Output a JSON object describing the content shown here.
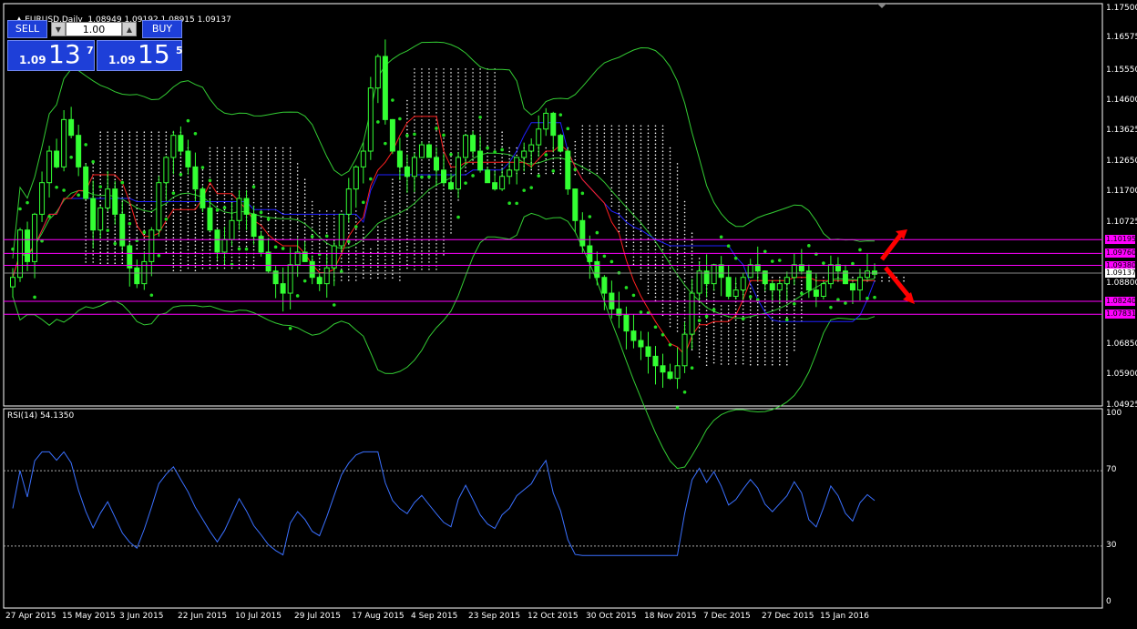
{
  "header": {
    "symbol": "EURUSD",
    "timeframe": ",Daily",
    "ohlc": "1.08949 1.09192 1.08915 1.09137"
  },
  "trade_panel": {
    "sell_label": "SELL",
    "buy_label": "BUY",
    "lot": "1.00",
    "sell_small": "1.09",
    "sell_big": "13",
    "sell_sup": "7",
    "buy_small": "1.09",
    "buy_big": "15",
    "buy_sup": "5",
    "spin_down": "▼",
    "spin_up": "▲"
  },
  "price_axis": {
    "labels": [
      "1.17500",
      "1.16575",
      "1.15550",
      "1.14600",
      "1.13625",
      "1.12650",
      "1.11700",
      "1.10725",
      "1.08800",
      "1.06850",
      "1.05900",
      "1.04925"
    ],
    "current_price": "1.09137",
    "level_tags": [
      "1.10195",
      "1.09760",
      "1.09380",
      "1.08240",
      "1.07831"
    ]
  },
  "rsi": {
    "title": "RSI(14) 54.1350",
    "axis_labels": [
      "100",
      "70",
      "30",
      "0"
    ]
  },
  "time_axis": {
    "labels": [
      "27 Apr 2015",
      "15 May 2015",
      "3 Jun 2015",
      "22 Jun 2015",
      "10 Jul 2015",
      "29 Jul 2015",
      "17 Aug 2015",
      "4 Sep 2015",
      "23 Sep 2015",
      "12 Oct 2015",
      "30 Oct 2015",
      "18 Nov 2015",
      "7 Dec 2015",
      "27 Dec 2015",
      "15 Jan 2016"
    ]
  },
  "colors": {
    "background": "#000000",
    "candle": "#33ff33",
    "tenkan": "#ff2020",
    "kijun": "#2020ff",
    "bands": "#33cc33",
    "sar": "#22dd22",
    "cloud": "#ffffff",
    "level_line": "#ff00ff",
    "rsi_line": "#3a70ff",
    "arrow": "#ff0000",
    "trade_button": "#1e3fd8"
  },
  "chart_data": {
    "type": "candlestick",
    "symbol": "EURUSD",
    "timeframe": "Daily",
    "price_range": [
      1.04925,
      1.175
    ],
    "closes": [
      1.09,
      1.105,
      1.095,
      1.11,
      1.12,
      1.13,
      1.125,
      1.14,
      1.135,
      1.125,
      1.115,
      1.105,
      1.112,
      1.118,
      1.11,
      1.1,
      1.093,
      1.088,
      1.095,
      1.105,
      1.12,
      1.128,
      1.135,
      1.13,
      1.125,
      1.118,
      1.112,
      1.105,
      1.098,
      1.102,
      1.108,
      1.115,
      1.11,
      1.103,
      1.098,
      1.092,
      1.088,
      1.085,
      1.094,
      1.098,
      1.095,
      1.09,
      1.088,
      1.093,
      1.1,
      1.11,
      1.118,
      1.125,
      1.13,
      1.15,
      1.16,
      1.14,
      1.13,
      1.125,
      1.122,
      1.128,
      1.132,
      1.128,
      1.124,
      1.12,
      1.118,
      1.128,
      1.135,
      1.13,
      1.124,
      1.12,
      1.118,
      1.122,
      1.124,
      1.128,
      1.13,
      1.132,
      1.137,
      1.142,
      1.135,
      1.13,
      1.118,
      1.108,
      1.1,
      1.095,
      1.09,
      1.085,
      1.08,
      1.078,
      1.073,
      1.07,
      1.068,
      1.065,
      1.062,
      1.06,
      1.058,
      1.062,
      1.072,
      1.085,
      1.092,
      1.088,
      1.094,
      1.09,
      1.084,
      1.086,
      1.09,
      1.094,
      1.092,
      1.088,
      1.086,
      1.088,
      1.09,
      1.094,
      1.092,
      1.086,
      1.084,
      1.088,
      1.094,
      1.092,
      1.088,
      1.086,
      1.09,
      1.092,
      1.091
    ],
    "rsi_period": 14,
    "rsi_last": 54.135,
    "rsi_levels": [
      70,
      30
    ],
    "rsi_range": [
      0,
      100
    ],
    "horizontal_levels": [
      1.10195,
      1.0976,
      1.0938,
      1.0824,
      1.07831
    ],
    "current_price": 1.09137,
    "date_range": [
      "2015-04-27",
      "2016-01-26"
    ]
  }
}
